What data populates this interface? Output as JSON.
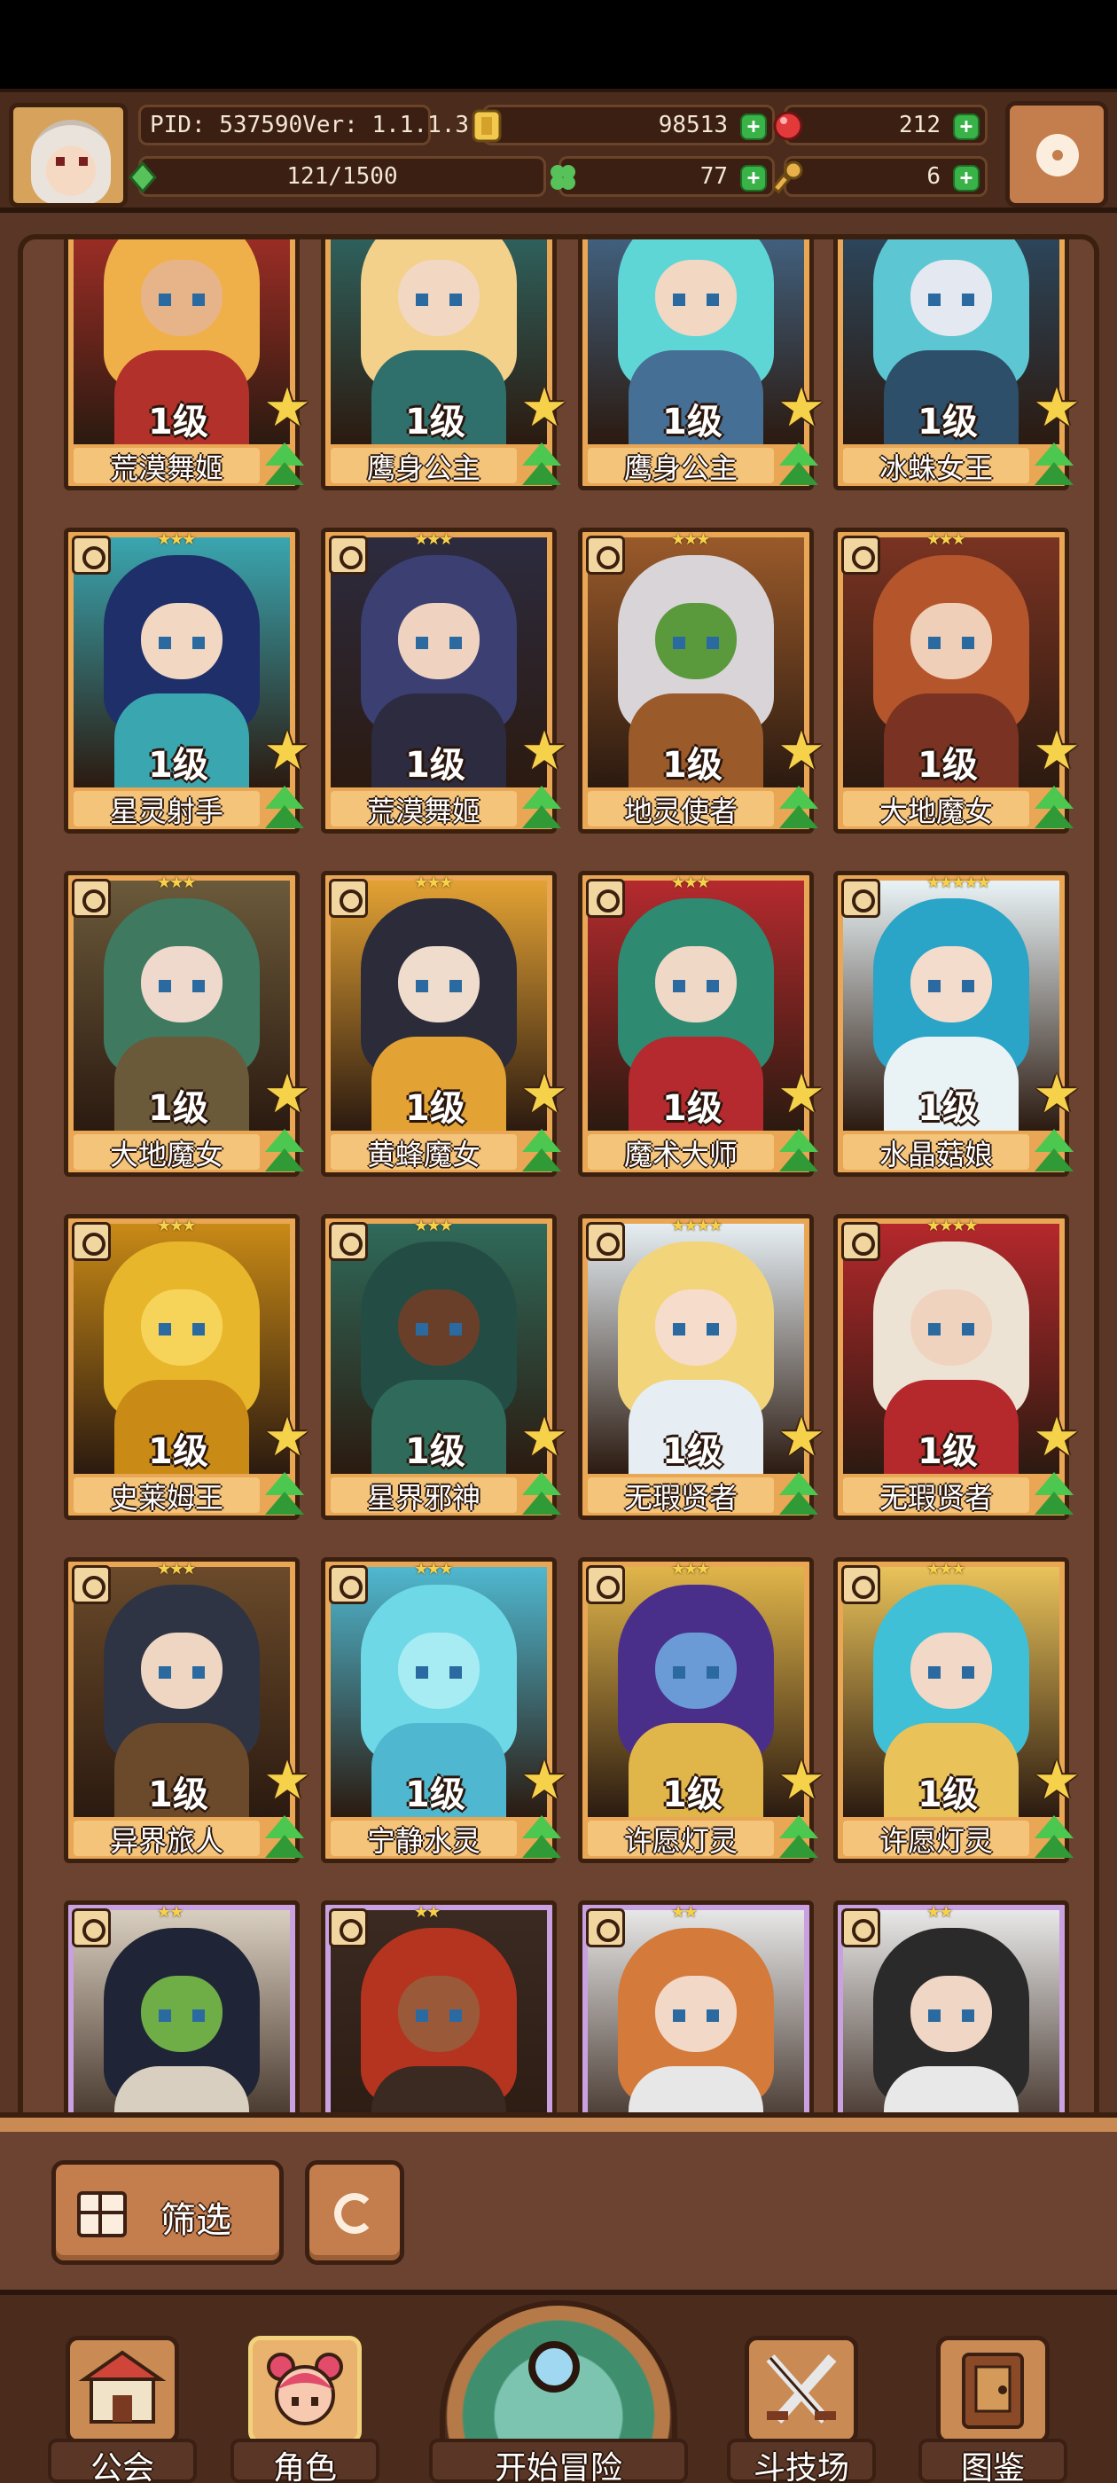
{
  "header": {
    "pid": "PID: 537590",
    "version": "Ver: 1.1.1.3",
    "gold": "98513",
    "gems": "212",
    "exp": "121/1500",
    "clover": "77",
    "keys": "6"
  },
  "heroes": [
    {
      "level": "1级",
      "name": "荒漠舞姬",
      "stars": "",
      "rarity": "orange",
      "palette": [
        "#f0b049",
        "#e7b48a",
        "#b2312a"
      ]
    },
    {
      "level": "1级",
      "name": "鹰身公主",
      "stars": "",
      "rarity": "orange",
      "palette": [
        "#f3d18a",
        "#f2d7c3",
        "#2f6f6c"
      ]
    },
    {
      "level": "1级",
      "name": "鹰身公主",
      "stars": "",
      "rarity": "orange",
      "palette": [
        "#5fd6d6",
        "#f2d7c3",
        "#466f95"
      ]
    },
    {
      "level": "1级",
      "name": "冰蛛女王",
      "stars": "",
      "rarity": "orange",
      "palette": [
        "#5cc7d2",
        "#e4e8f0",
        "#2d4f6a"
      ]
    },
    {
      "level": "1级",
      "name": "星灵射手",
      "stars": "★★★",
      "rarity": "orange",
      "palette": [
        "#1e2f6a",
        "#f2d7c3",
        "#3aa6b0"
      ]
    },
    {
      "level": "1级",
      "name": "荒漠舞姬",
      "stars": "★★★",
      "rarity": "orange",
      "palette": [
        "#3b3f72",
        "#efd3c0",
        "#2c2b3f"
      ]
    },
    {
      "level": "1级",
      "name": "地灵使者",
      "stars": "★★★",
      "rarity": "orange",
      "palette": [
        "#d9d4d8",
        "#5a9a3d",
        "#9a5a2a"
      ]
    },
    {
      "level": "1级",
      "name": "大地魔女",
      "stars": "★★★",
      "rarity": "orange",
      "palette": [
        "#b5552c",
        "#efcfb8",
        "#7a3322"
      ]
    },
    {
      "level": "1级",
      "name": "大地魔女",
      "stars": "★★★",
      "rarity": "orange",
      "palette": [
        "#3f7a60",
        "#efd9cc",
        "#6b5a3a"
      ]
    },
    {
      "level": "1级",
      "name": "黄蜂魔女",
      "stars": "★★★",
      "rarity": "orange",
      "palette": [
        "#2b2b3a",
        "#efdccc",
        "#e3a234"
      ]
    },
    {
      "level": "1级",
      "name": "魔术大师",
      "stars": "★★★",
      "rarity": "orange",
      "palette": [
        "#2f8a72",
        "#efd8c6",
        "#b52a2e"
      ]
    },
    {
      "level": "1级",
      "name": "水晶菇娘",
      "stars": "★★★★★",
      "rarity": "orange",
      "palette": [
        "#2aa4c7",
        "#f4dccd",
        "#e9f3f6"
      ]
    },
    {
      "level": "1级",
      "name": "史莱姆王",
      "stars": "★★★",
      "rarity": "orange",
      "palette": [
        "#e8b62a",
        "#f6d45a",
        "#c98a16"
      ]
    },
    {
      "level": "1级",
      "name": "星界邪神",
      "stars": "★★★",
      "rarity": "orange",
      "palette": [
        "#234d44",
        "#6a3f2a",
        "#2f6a5a"
      ]
    },
    {
      "level": "1级",
      "name": "无瑕贤者",
      "stars": "★★★★",
      "rarity": "orange",
      "palette": [
        "#f2d57a",
        "#f6dccb",
        "#e6eef3"
      ]
    },
    {
      "level": "1级",
      "name": "无瑕贤者",
      "stars": "★★★★",
      "rarity": "orange",
      "palette": [
        "#ede3d5",
        "#f0d3bf",
        "#b5282c"
      ]
    },
    {
      "level": "1级",
      "name": "异界旅人",
      "stars": "★★★",
      "rarity": "orange",
      "palette": [
        "#2e3444",
        "#efd6c2",
        "#6a4a2a"
      ]
    },
    {
      "level": "1级",
      "name": "宁静水灵",
      "stars": "★★★",
      "rarity": "orange",
      "palette": [
        "#6fd8e6",
        "#a7ecf2",
        "#4fb8d0"
      ]
    },
    {
      "level": "1级",
      "name": "许愿灯灵",
      "stars": "★★★",
      "rarity": "orange",
      "palette": [
        "#4a2f8a",
        "#6a9bd6",
        "#e0b54a"
      ]
    },
    {
      "level": "1级",
      "name": "许愿灯灵",
      "stars": "★★★",
      "rarity": "orange",
      "palette": [
        "#3fc0d6",
        "#f2d8c6",
        "#e9c35a"
      ]
    },
    {
      "level": "",
      "name": "",
      "stars": "★★",
      "rarity": "purple",
      "palette": [
        "#1f2536",
        "#6fae47",
        "#d9cfc0"
      ]
    },
    {
      "level": "",
      "name": "",
      "stars": "★★",
      "rarity": "purple",
      "palette": [
        "#b5341f",
        "#9a5a3a",
        "#3a2a22"
      ]
    },
    {
      "level": "",
      "name": "",
      "stars": "★★",
      "rarity": "purple",
      "palette": [
        "#d47a3a",
        "#f2d8c6",
        "#e7e7e7"
      ]
    },
    {
      "level": "",
      "name": "",
      "stars": "★★",
      "rarity": "purple",
      "palette": [
        "#2a2a2a",
        "#f0d6c4",
        "#e8e8e8"
      ]
    }
  ],
  "filter": {
    "label": "筛选"
  },
  "nav": {
    "guild": "公会",
    "hero": "角色",
    "adventure": "开始冒险",
    "arena": "斗技场",
    "codex": "图鉴"
  }
}
